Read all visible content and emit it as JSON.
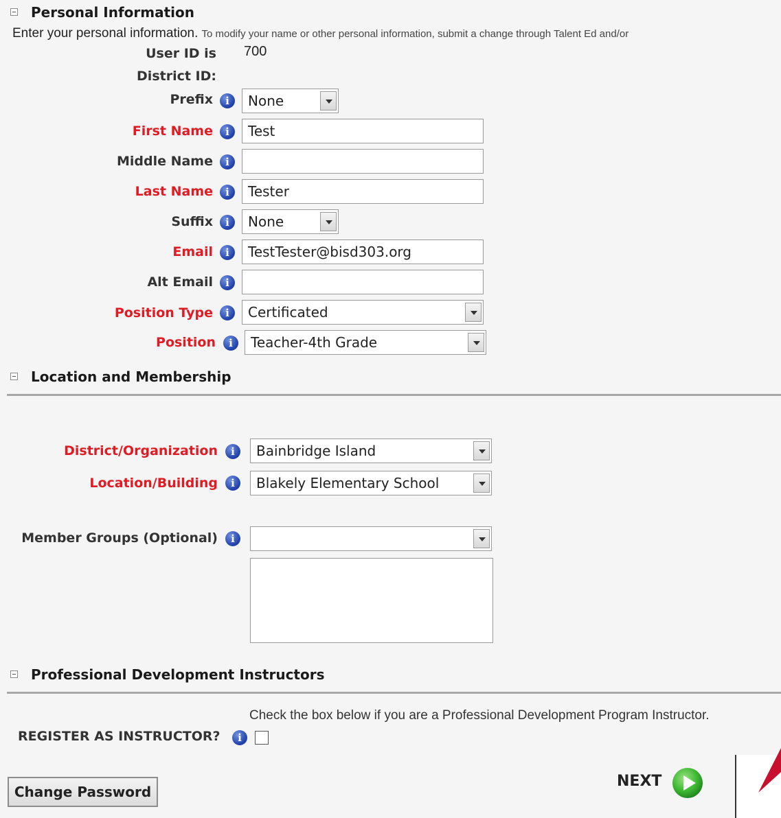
{
  "personal": {
    "section_title": "Personal Information",
    "intro_main": "Enter your personal information.",
    "intro_note": "To modify your name or other personal information, submit a change through Talent Ed and/or",
    "user_id_label": "User ID is",
    "user_id_value": "700",
    "district_id_label": "District ID:",
    "info_glyph": "i",
    "prefix": {
      "label": "Prefix",
      "value": "None"
    },
    "first_name": {
      "label": "First Name",
      "value": "Test"
    },
    "middle_name": {
      "label": "Middle Name",
      "value": ""
    },
    "last_name": {
      "label": "Last Name",
      "value": "Tester"
    },
    "suffix": {
      "label": "Suffix",
      "value": "None"
    },
    "email": {
      "label": "Email",
      "value": "TestTester@bisd303.org"
    },
    "alt_email": {
      "label": "Alt Email",
      "value": ""
    },
    "position_type": {
      "label": "Position Type",
      "value": "Certificated"
    },
    "position": {
      "label": "Position",
      "value": "Teacher-4th Grade"
    }
  },
  "location": {
    "section_title": "Location and Membership",
    "district": {
      "label": "District/Organization",
      "value": "Bainbridge Island"
    },
    "building": {
      "label": "Location/Building",
      "value": "Blakely Elementary School"
    },
    "member_groups": {
      "label": "Member Groups (Optional)",
      "value": ""
    }
  },
  "instructors": {
    "section_title": "Professional Development Instructors",
    "note": "Check the box below if you are a Professional Development Program Instructor.",
    "register_label": "REGISTER AS INSTRUCTOR?",
    "register_checked": false
  },
  "actions": {
    "change_password": "Change Password",
    "next": "NEXT"
  },
  "colors": {
    "required_label": "#e01b24",
    "next_icon": "#3cb832",
    "annotation_arrow": "#c8102e"
  },
  "icons": [
    "collapse-toggle-icon",
    "info-icon",
    "dropdown-arrow-icon",
    "play-arrow-icon",
    "red-arrow-annotation"
  ]
}
